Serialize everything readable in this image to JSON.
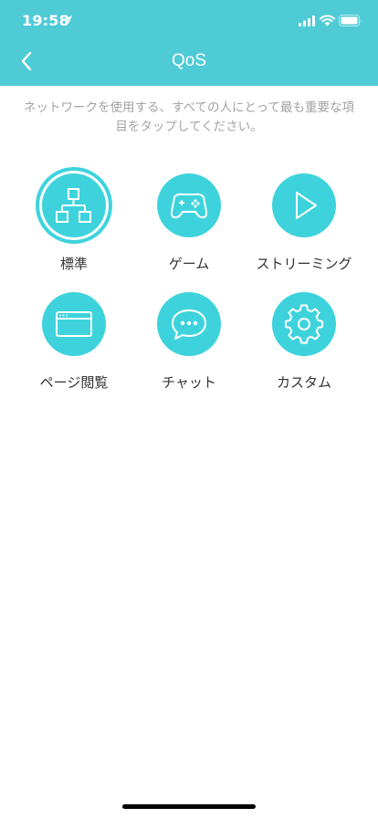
{
  "status_bar": {
    "time": "19:58"
  },
  "header": {
    "title": "QoS"
  },
  "description": "ネットワークを使用する、すべての人にとって最も重要な項目をタップしてください。",
  "options": [
    {
      "label": "標準",
      "icon": "network-icon",
      "selected": true
    },
    {
      "label": "ゲーム",
      "icon": "gamepad-icon",
      "selected": false
    },
    {
      "label": "ストリーミング",
      "icon": "play-icon",
      "selected": false
    },
    {
      "label": "ページ閲覧",
      "icon": "browser-icon",
      "selected": false
    },
    {
      "label": "チャット",
      "icon": "chat-bubble-icon",
      "selected": false
    },
    {
      "label": "カスタム",
      "icon": "gear-icon",
      "selected": false
    }
  ],
  "colors": {
    "header": "#4fcbd6",
    "accent": "#3ed3dc",
    "description_text": "#a3a3a3",
    "label_text": "#333333"
  }
}
